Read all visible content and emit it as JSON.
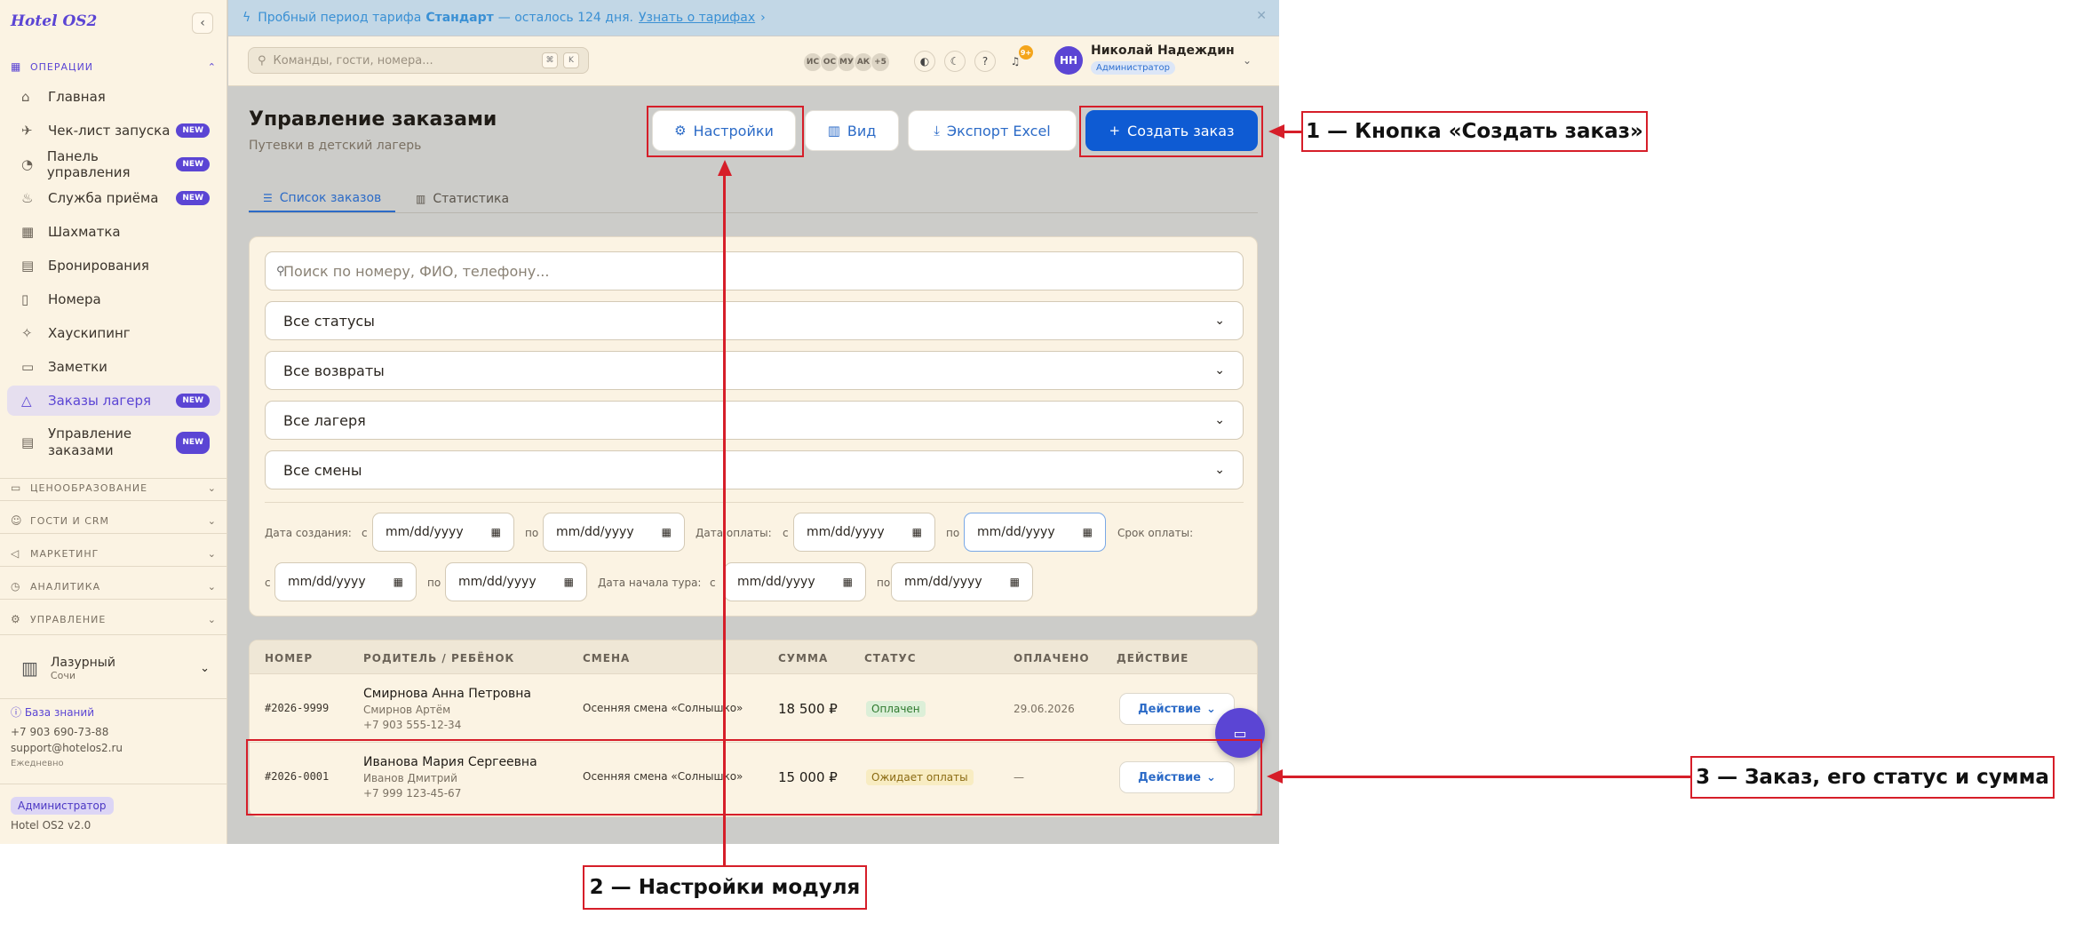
{
  "app": {
    "logo": "Hotel OS2",
    "version": "Hotel OS2 v2.0"
  },
  "sidebar": {
    "section_ops": "ОПЕРАЦИИ",
    "items": [
      {
        "label": "Главная",
        "icon": "home-icon",
        "badge": ""
      },
      {
        "label": "Чек-лист запуска",
        "icon": "rocket-icon",
        "badge": "NEW"
      },
      {
        "label": "Панель управления",
        "icon": "gauge-icon",
        "badge": "NEW"
      },
      {
        "label": "Служба приёма",
        "icon": "bell-icon",
        "badge": "NEW"
      },
      {
        "label": "Шахматка",
        "icon": "grid-icon",
        "badge": ""
      },
      {
        "label": "Бронирования",
        "icon": "clipboard-icon",
        "badge": ""
      },
      {
        "label": "Номера",
        "icon": "door-icon",
        "badge": ""
      },
      {
        "label": "Хаускипинг",
        "icon": "sparkle-icon",
        "badge": ""
      },
      {
        "label": "Заметки",
        "icon": "note-icon",
        "badge": ""
      },
      {
        "label": "Заказы лагеря",
        "icon": "tent-icon",
        "badge": "NEW"
      },
      {
        "label": "Управление заказами",
        "icon": "list-icon",
        "badge": "NEW"
      }
    ],
    "sections": [
      "ЦЕНООБРАЗОВАНИЕ",
      "ГОСТИ И CRM",
      "МАРКЕТИНГ",
      "АНАЛИТИКА",
      "УПРАВЛЕНИЕ"
    ],
    "property": {
      "name": "Лазурный",
      "city": "Сочи"
    },
    "kb": "База знаний",
    "phone": "+7 903 690-73-88",
    "email": "support@hotelos2.ru",
    "hours": "Ежедневно",
    "role": "Администратор"
  },
  "banner": {
    "prefix": "Пробный период тарифа",
    "plan": "Стандарт",
    "suffix": "— осталось 124 дня.",
    "link": "Узнать о тарифах"
  },
  "topbar": {
    "search_placeholder": "Команды, гости, номера...",
    "key1": "⌘",
    "key2": "K",
    "users": [
      "ИС",
      "ОС",
      "МУ",
      "АК",
      "+5"
    ],
    "notif_count": "9+",
    "user_initials": "НН",
    "user_name": "Николай Надеждин",
    "user_role": "Администратор"
  },
  "page": {
    "title": "Управление заказами",
    "subtitle": "Путевки в детский лагерь",
    "btn_settings": "Настройки",
    "btn_view": "Вид",
    "btn_export": "Экспорт Excel",
    "btn_create": "Создать заказ",
    "tab_list": "Список заказов",
    "tab_stats": "Статистика"
  },
  "filters": {
    "search_placeholder": "Поиск по номеру, ФИО, телефону...",
    "status": "Все статусы",
    "refunds": "Все возвраты",
    "camps": "Все лагеря",
    "shifts": "Все смены",
    "created_label": "Дата создания:",
    "paid_label": "Дата оплаты:",
    "due_label": "Срок оплаты:",
    "tour_label": "Дата начала тура:",
    "from": "с",
    "to": "по",
    "date_placeholder": "mm/dd/yyyy"
  },
  "table": {
    "headers": [
      "НОМЕР",
      "РОДИТЕЛЬ / РЕБЁНОК",
      "СМЕНА",
      "СУММА",
      "СТАТУС",
      "ОПЛАЧЕНО",
      "ДЕЙСТВИЕ"
    ],
    "rows": [
      {
        "num": "#2026-9999",
        "parent": "Смирнова Анна Петровна",
        "child": "Смирнов Артём",
        "phone": "+7 903 555-12-34",
        "shift": "Осенняя смена «Солнышко»",
        "sum": "18 500 ₽",
        "status": "Оплачен",
        "paid": "29.06.2026",
        "action": "Действие"
      },
      {
        "num": "#2026-0001",
        "parent": "Иванова Мария Сергеевна",
        "child": "Иванов Дмитрий",
        "phone": "+7 999 123-45-67",
        "shift": "Осенняя смена «Солнышко»",
        "sum": "15 000 ₽",
        "status": "Ожидает оплаты",
        "paid": "—",
        "action": "Действие"
      }
    ]
  },
  "annotations": {
    "a1": "1 — Кнопка «Создать заказ»",
    "a2": "2 — Настройки модуля",
    "a3": "3 — Заказ, его статус и сумма"
  },
  "colors": {
    "accent": "#5b45d4",
    "primary": "#0e5bd3",
    "annotation": "#d61e29"
  }
}
